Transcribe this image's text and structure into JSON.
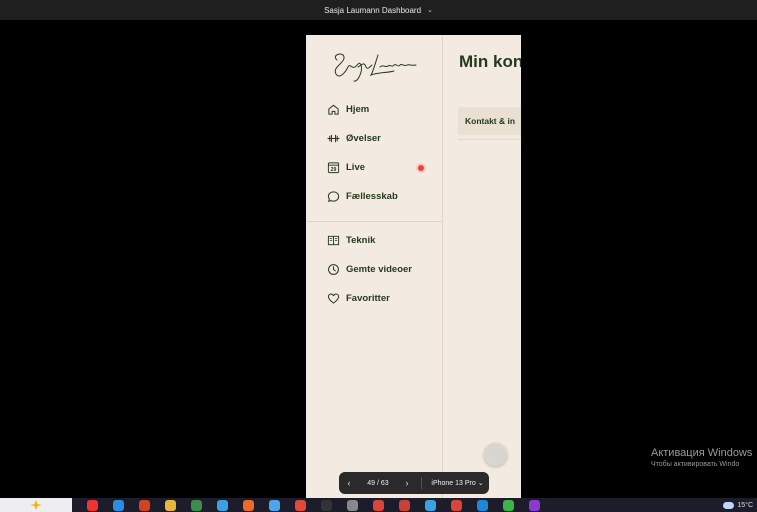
{
  "window": {
    "title": "Sasja Laumann Dashboard"
  },
  "brand": {
    "logo_text": "Sasja Laumann"
  },
  "sidebar": {
    "primary_items": [
      {
        "label": "Hjem",
        "icon": "home-icon"
      },
      {
        "label": "Øvelser",
        "icon": "dumbbell-icon"
      },
      {
        "label": "Live",
        "icon": "calendar-icon",
        "calendar_day": "29",
        "badge": "live-dot"
      },
      {
        "label": "Fællesskab",
        "icon": "chat-bubble-icon"
      }
    ],
    "secondary_items": [
      {
        "label": "Teknik",
        "icon": "book-icon"
      },
      {
        "label": "Gemte videoer",
        "icon": "clock-icon"
      },
      {
        "label": "Favoritter",
        "icon": "heart-icon"
      }
    ]
  },
  "main": {
    "title": "Min kon",
    "tab_label": "Kontakt & in"
  },
  "device_toolbar": {
    "counter": "49 / 63",
    "device": "iPhone 13 Pro",
    "prev_symbol": "‹",
    "next_symbol": "›"
  },
  "watermark": {
    "line1": "Активация Windows",
    "line2": "Чтобы активировать Windo"
  },
  "tray": {
    "temperature": "15°C"
  },
  "colors": {
    "sidebar_bg": "#f3ebe1",
    "text_primary": "#253a1f",
    "live_dot": "#e8453a"
  }
}
